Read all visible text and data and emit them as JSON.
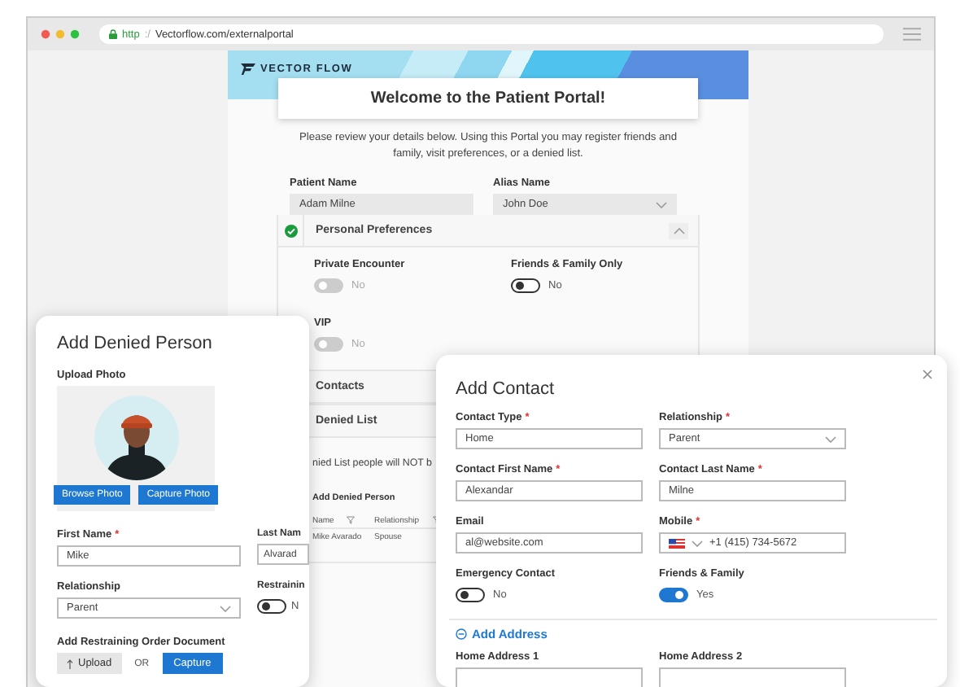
{
  "browser": {
    "scheme": "http",
    "separator": ":/",
    "address": "Vectorflow.com/externalportal"
  },
  "portal": {
    "logo": "VECTOR FLOW",
    "welcome": "Welcome to the Patient Portal!",
    "intro": "Please review your details below. Using this Portal you may register friends and family, visit preferences, or a denied list.",
    "fields": [
      {
        "label": "Patient Name",
        "value": "Adam Milne",
        "kind": "text"
      },
      {
        "label": "Alias Name",
        "value": "John Doe",
        "kind": "select"
      }
    ],
    "sections": [
      {
        "title": "Personal Preferences",
        "completed": true,
        "expanded": true,
        "toggles": [
          {
            "label": "Private Encounter",
            "on": false,
            "disabled": true,
            "state_text": "No"
          },
          {
            "label": "Friends & Family Only",
            "on": false,
            "disabled": false,
            "state_text": "No"
          },
          {
            "label": "VIP",
            "on": false,
            "disabled": true,
            "state_text": "No"
          }
        ]
      },
      {
        "title": "Contacts",
        "expanded": false
      },
      {
        "title": "Denied List",
        "expanded": true,
        "note": "nied List people will NOT b",
        "table": {
          "title": "Add Denied Person",
          "columns": [
            "Name",
            "Relationship"
          ],
          "rows": [
            [
              "Mike Avarado",
              "Spouse"
            ]
          ]
        }
      }
    ]
  },
  "denied_dialog": {
    "title": "Add Denied Person",
    "photo_label": "Upload Photo",
    "photo_buttons": [
      "Browse Photo",
      "Capture Photo"
    ],
    "fields": [
      {
        "label": "First Name",
        "required_mark": "*",
        "value": "Mike",
        "kind": "text"
      },
      {
        "label": "Last Nam",
        "value": "Alvarad",
        "kind": "text"
      },
      {
        "label": "Relationship",
        "value": "Parent",
        "kind": "select"
      },
      {
        "label": "Restrainin",
        "kind": "toggle",
        "on": false,
        "state_text": "N"
      }
    ],
    "document_label": "Add Restraining Order Document",
    "upload_button": "Upload",
    "or_text": "OR",
    "capture_button": "Capture"
  },
  "contact_dialog": {
    "title": "Add Contact",
    "fields": [
      {
        "label": "Contact Type",
        "required_mark": "*",
        "value": "Home",
        "kind": "text"
      },
      {
        "label": "Relationship",
        "required_mark": "*",
        "value": "Parent",
        "kind": "select"
      },
      {
        "label": "Contact First Name",
        "required_mark": "*",
        "value": "Alexandar",
        "kind": "text"
      },
      {
        "label": "Contact Last Name",
        "required_mark": "*",
        "value": "Milne",
        "kind": "text"
      },
      {
        "label": "Email",
        "value": "al@website.com",
        "kind": "text"
      },
      {
        "label": "Mobile",
        "required_mark": "*",
        "number": "+1 (415) 734-5672",
        "kind": "phone"
      },
      {
        "label": "Emergency Contact",
        "kind": "toggle",
        "on": false,
        "state_text": "No"
      },
      {
        "label": "Friends & Family",
        "kind": "toggle",
        "on": true,
        "state_text": "Yes"
      }
    ],
    "address_link": "Add Address",
    "address_fields": [
      {
        "label": "Home Address 1",
        "kind": "text"
      },
      {
        "label": "Home Address 2",
        "kind": "text"
      }
    ]
  }
}
